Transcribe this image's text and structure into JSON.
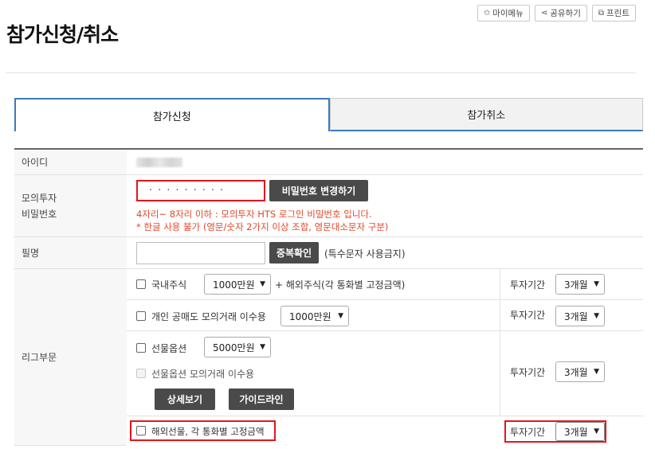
{
  "header": {
    "title": "참가신청/취소",
    "buttons": [
      {
        "icon": "star-icon",
        "glyph": "✩",
        "label": "마이메뉴"
      },
      {
        "icon": "share-icon",
        "glyph": "⋖",
        "label": "공유하기"
      },
      {
        "icon": "print-icon",
        "glyph": "⧉",
        "label": "프린트"
      }
    ]
  },
  "tabs": [
    {
      "label": "참가신청",
      "active": true
    },
    {
      "label": "참가취소",
      "active": false
    }
  ],
  "form": {
    "id_label": "아이디",
    "pw_label_line1": "모의투자",
    "pw_label_line2": "비밀번호",
    "pw_mask": "·········",
    "pw_change_button": "비밀번호 변경하기",
    "pw_warn1": "4자리~ 8자리 이하 : 모의투자 HTS 로그인 비밀번호 입니다.",
    "pw_warn2": "* 한글 사용 불가 (영문/숫자 2가지 이상 조합, 영문대소문자 구분)",
    "nick_label": "필명",
    "nick_value": "",
    "dup_check_button": "중복확인",
    "nick_hint": "(특수문자 사용금지)",
    "league_label": "리그부문",
    "league": {
      "domestic_label": "국내주식",
      "domestic_amount": "1000만원",
      "domestic_suffix": "+ 해외주식(각 통화별 고정금액)",
      "ipo_label": "개인 공매도 모의거래 이수용",
      "ipo_amount": "1000만원",
      "futures_label": "선물옵션",
      "futures_amount": "5000만원",
      "futures_edu_label": "선물옵션 모의거래 이수용",
      "detail_button": "상세보기",
      "guide_button": "가이드라인",
      "overseas_label": "해외선물, 각 통화별 고정금액",
      "period_label": "투자기간",
      "period_value": "3개월"
    }
  },
  "colors": {
    "accent_blue": "#3b7bbf",
    "highlight_red": "#e4151b",
    "warning_text": "#e0492b",
    "dark_button": "#4a4a4a"
  }
}
